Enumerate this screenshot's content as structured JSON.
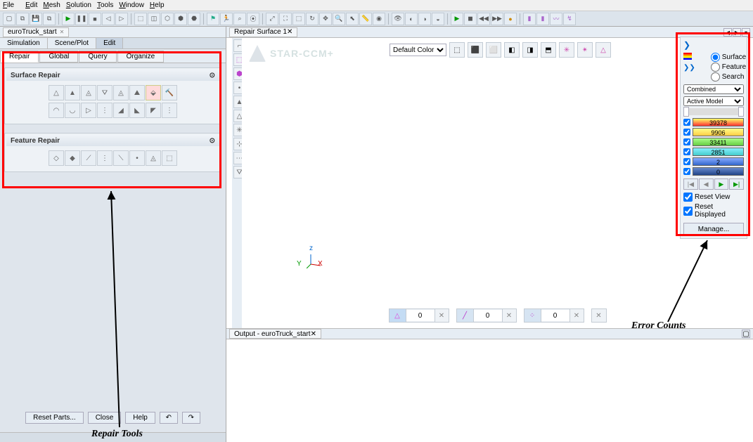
{
  "menu": {
    "file": "File",
    "edit": "Edit",
    "mesh": "Mesh",
    "solution": "Solution",
    "tools": "Tools",
    "window": "Window",
    "help": "Help"
  },
  "doc_tab": {
    "name": "euroTruck_start"
  },
  "subtabs": {
    "simulation": "Simulation",
    "sceneplot": "Scene/Plot",
    "edit": "Edit"
  },
  "tooltabs": {
    "repair": "Repair",
    "global": "Global",
    "query": "Query",
    "organize": "Organize"
  },
  "sections": {
    "surface_repair": "Surface Repair",
    "feature_repair": "Feature Repair"
  },
  "bottom": {
    "reset_parts": "Reset Parts...",
    "close": "Close",
    "help": "Help"
  },
  "scene_tab": {
    "name": "Repair Surface 1"
  },
  "watermark": "STAR-CCM+",
  "color_select": {
    "label": "Default Color"
  },
  "selbar": {
    "tri": "0",
    "edge": "0",
    "vert": "0"
  },
  "errorpanel": {
    "radio_surface": "Surface",
    "radio_feature": "Feature",
    "radio_search": "Search",
    "combined": "Combined",
    "active_model": "Active Model",
    "counts": [
      {
        "val": "39378",
        "cls": "c-red"
      },
      {
        "val": "9906",
        "cls": "c-yel"
      },
      {
        "val": "33411",
        "cls": "c-grn"
      },
      {
        "val": "2851",
        "cls": "c-cyn"
      },
      {
        "val": "2",
        "cls": "c-blu"
      },
      {
        "val": "0",
        "cls": "c-dk"
      }
    ],
    "reset_view": "Reset View",
    "reset_displayed": "Reset Displayed",
    "manage": "Manage..."
  },
  "output_tab": "Output - euroTruck_start",
  "annot": {
    "repair_tools": "Repair Tools",
    "error_counts": "Error Counts"
  }
}
